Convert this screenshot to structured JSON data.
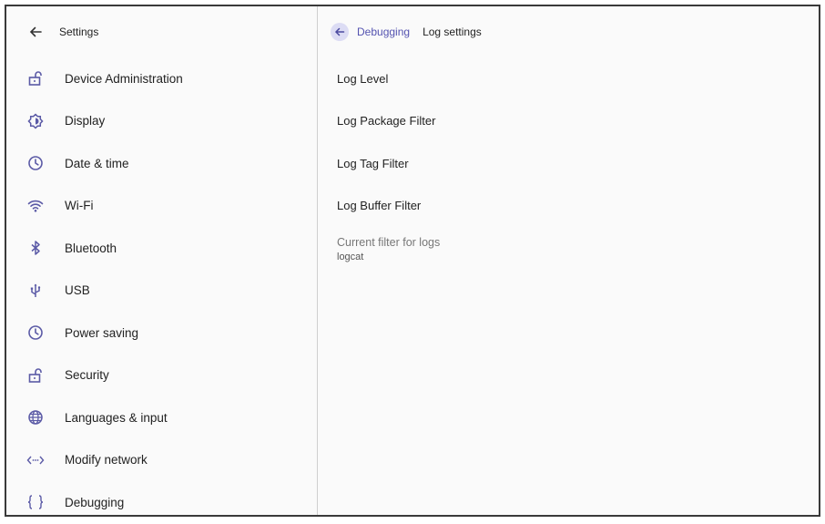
{
  "left_panel": {
    "title": "Settings",
    "items": [
      {
        "label": "Device Administration",
        "icon": "lock-open-icon"
      },
      {
        "label": "Display",
        "icon": "brightness-icon"
      },
      {
        "label": "Date & time",
        "icon": "clock-icon"
      },
      {
        "label": "Wi-Fi",
        "icon": "wifi-icon"
      },
      {
        "label": "Bluetooth",
        "icon": "bluetooth-icon"
      },
      {
        "label": "USB",
        "icon": "usb-icon"
      },
      {
        "label": "Power saving",
        "icon": "clock-icon"
      },
      {
        "label": "Security",
        "icon": "lock-open-icon"
      },
      {
        "label": "Languages & input",
        "icon": "globe-icon"
      },
      {
        "label": "Modify network",
        "icon": "code-arrows-icon"
      },
      {
        "label": "Debugging",
        "icon": "braces-icon"
      }
    ]
  },
  "right_panel": {
    "breadcrumb_parent": "Debugging",
    "breadcrumb_current": "Log settings",
    "options": [
      "Log Level",
      "Log Package Filter",
      "Log Tag Filter",
      "Log Buffer Filter"
    ],
    "current_filter_title": "Current filter for logs",
    "current_filter_value": "logcat"
  },
  "colors": {
    "accent": "#5b5aa6",
    "background": "#fafafa",
    "divider": "#cfcfcf"
  }
}
